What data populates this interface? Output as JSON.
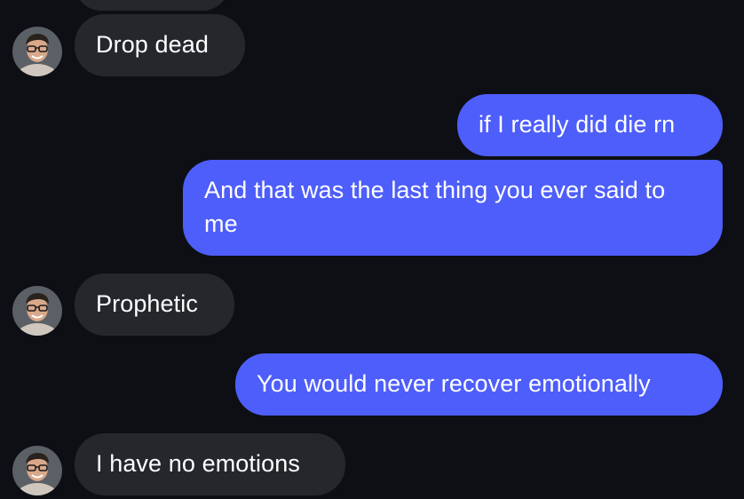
{
  "conversation": {
    "messages": [
      {
        "direction": "incoming",
        "text": "Drop dead"
      },
      {
        "direction": "outgoing",
        "text": "if I really did die rn"
      },
      {
        "direction": "outgoing",
        "text": "And that was the last thing you ever said to me"
      },
      {
        "direction": "incoming",
        "text": "Prophetic"
      },
      {
        "direction": "outgoing",
        "text": "You would never recover emotionally"
      },
      {
        "direction": "incoming",
        "text": "I have no emotions"
      }
    ]
  },
  "colors": {
    "background": "#0d0f14",
    "incoming_bubble": "#25272d",
    "outgoing_bubble": "#4e5efa",
    "text": "#ffffff"
  },
  "icons": {
    "avatar": "contact-avatar-photo"
  }
}
